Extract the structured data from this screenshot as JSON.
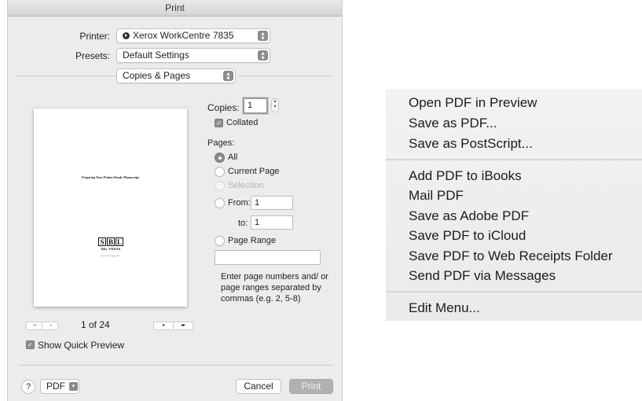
{
  "dialog": {
    "title": "Print",
    "printer": {
      "label": "Printer:",
      "value": "Xerox WorkCentre 7835"
    },
    "presets": {
      "label": "Presets:",
      "value": "Default Settings"
    },
    "section_popup": "Copies & Pages",
    "preview": {
      "doc_title": "Preparing Your Printer-Ready Manuscript",
      "logo_letters": [
        "S",
        "B",
        "L"
      ],
      "logo_subtitle": "SBL PRESS",
      "revision": "Revised 28 August 2015"
    },
    "navigation": {
      "first": "◂◂",
      "prev": "◂",
      "page_indicator": "1 of 24",
      "next": "▸",
      "last": "▸▸"
    },
    "show_quick_preview": "Show Quick Preview",
    "copies": {
      "label": "Copies:",
      "value": "1"
    },
    "collated": "Collated",
    "pages_label": "Pages:",
    "options": {
      "all": "All",
      "current_page": "Current Page",
      "selection": "Selection",
      "from_label": "From:",
      "from_value": "1",
      "to_label": "to:",
      "to_value": "1",
      "page_range": "Page Range"
    },
    "hint": "Enter page numbers and/ or page ranges separated by commas (e.g. 2, 5-8)",
    "help": "?",
    "pdf_button": "PDF",
    "cancel_button": "Cancel",
    "print_button": "Print"
  },
  "pdf_menu": {
    "group1": [
      "Open PDF in Preview",
      "Save as PDF...",
      "Save as PostScript..."
    ],
    "group2": [
      "Add PDF to iBooks",
      "Mail PDF",
      "Save as Adobe PDF",
      "Save PDF to iCloud",
      "Save PDF to Web Receipts Folder",
      "Send PDF via Messages"
    ],
    "group3": [
      "Edit Menu..."
    ]
  }
}
